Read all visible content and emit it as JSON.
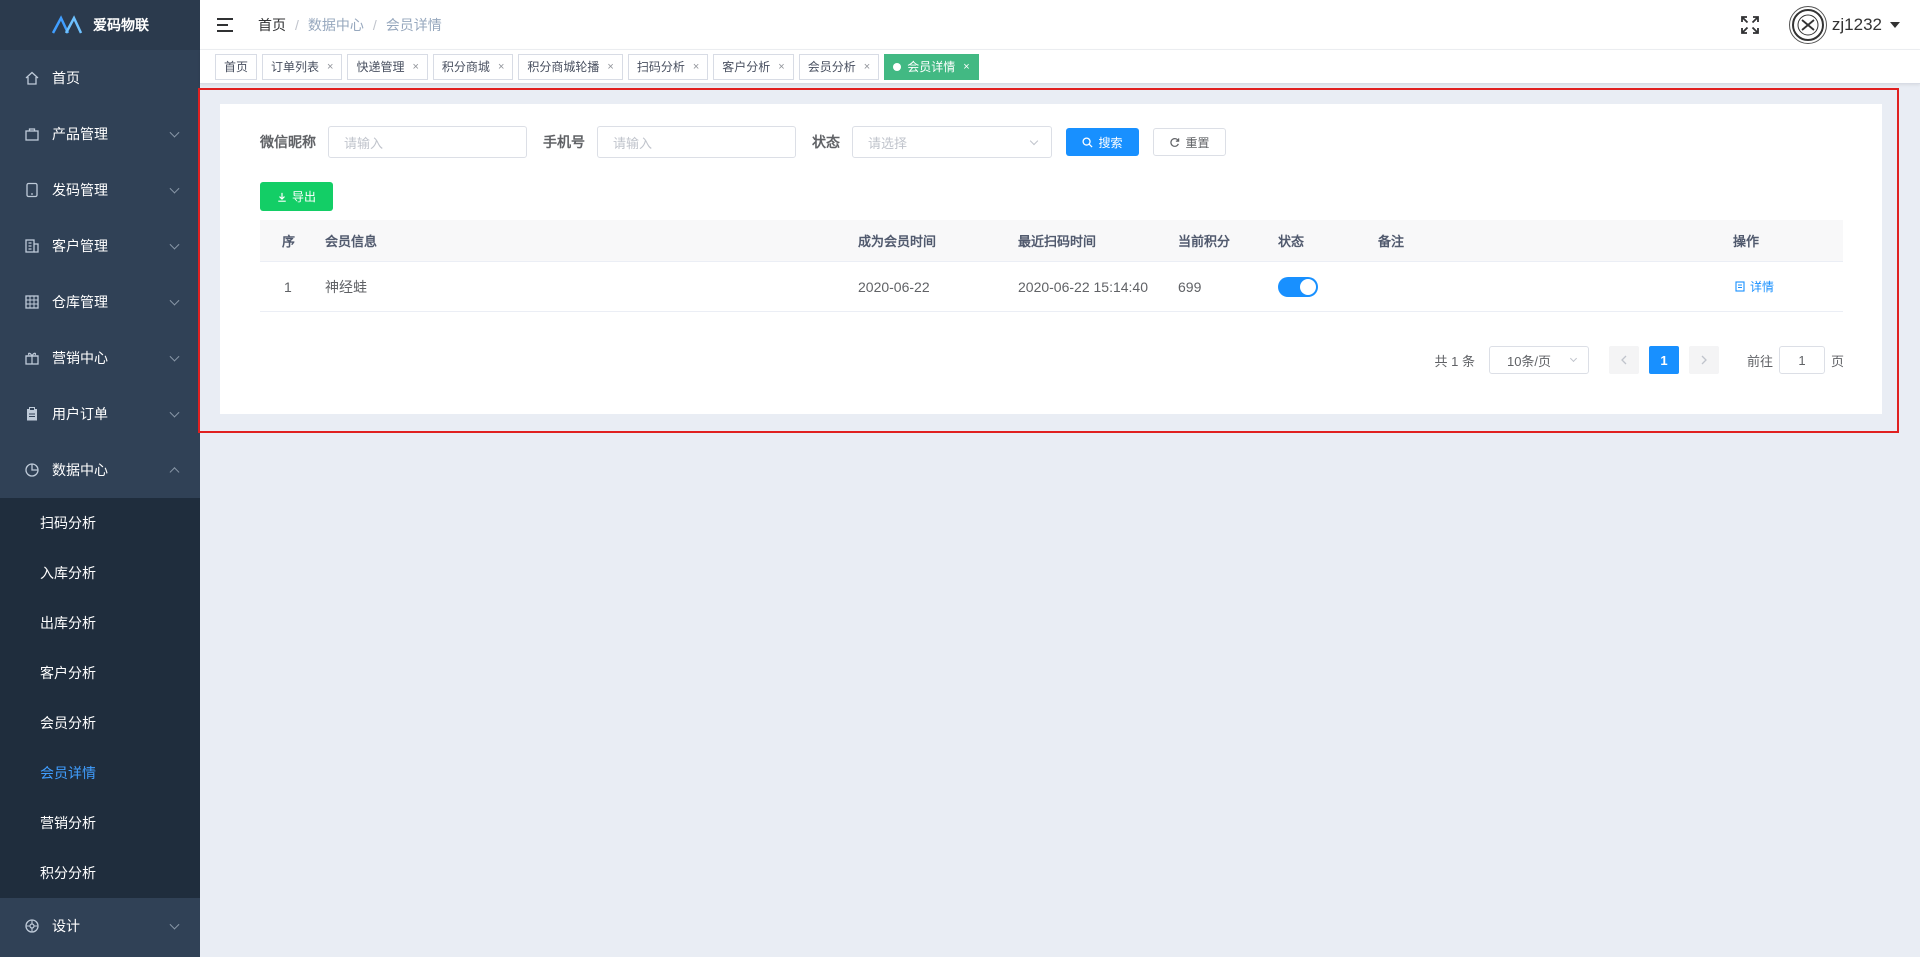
{
  "app": {
    "title": "爱码物联"
  },
  "sidebar": {
    "items": [
      {
        "label": "首页",
        "icon": "home-icon"
      },
      {
        "label": "产品管理",
        "icon": "bag-icon"
      },
      {
        "label": "发码管理",
        "icon": "tablet-icon"
      },
      {
        "label": "客户管理",
        "icon": "building-icon"
      },
      {
        "label": "仓库管理",
        "icon": "grid-icon"
      },
      {
        "label": "营销中心",
        "icon": "gift-icon"
      },
      {
        "label": "用户订单",
        "icon": "clipboard-icon"
      },
      {
        "label": "数据中心",
        "icon": "pie-icon"
      }
    ],
    "sub_items": [
      "扫码分析",
      "入库分析",
      "出库分析",
      "客户分析",
      "会员分析",
      "会员详情",
      "营销分析",
      "积分分析"
    ],
    "last_item": {
      "label": "设计",
      "icon": "wheel-icon"
    }
  },
  "header": {
    "breadcrumb": [
      "首页",
      "数据中心",
      "会员详情"
    ],
    "username": "zj1232"
  },
  "tags": [
    "首页",
    "订单列表",
    "快递管理",
    "积分商城",
    "积分商城轮播",
    "扫码分析",
    "客户分析",
    "会员分析",
    "会员详情"
  ],
  "filter": {
    "nickname_label": "微信昵称",
    "nickname_placeholder": "请输入",
    "phone_label": "手机号",
    "phone_placeholder": "请输入",
    "status_label": "状态",
    "status_placeholder": "请选择",
    "search_label": "搜索",
    "reset_label": "重置"
  },
  "export_label": "导出",
  "table": {
    "columns": [
      "序",
      "会员信息",
      "成为会员时间",
      "最近扫码时间",
      "当前积分",
      "状态",
      "备注",
      "操作"
    ],
    "rows": [
      {
        "index": "1",
        "member": "神经蛙",
        "join_date": "2020-06-22",
        "last_scan": "2020-06-22 15:14:40",
        "points": "699",
        "status_on": true,
        "remark": "",
        "action": "详情"
      }
    ]
  },
  "pagination": {
    "total_text": "共 1 条",
    "page_size": "10条/页",
    "current_page": "1",
    "goto_label": "前往",
    "goto_value": "1",
    "page_suffix": "页"
  },
  "colors": {
    "sidebar_bg": "#304156",
    "primary": "#1890ff",
    "active_tag": "#42b983",
    "export": "#13ce66",
    "highlight_border": "#e02020"
  }
}
